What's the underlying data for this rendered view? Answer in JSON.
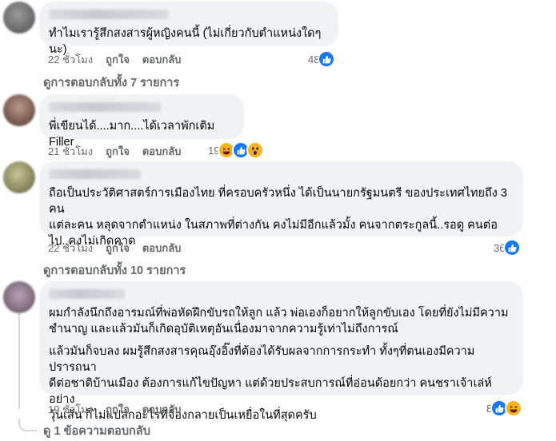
{
  "comments": [
    {
      "text": [
        "ทำไมเรารู้สึกสงสารผู้หญิงคนนี้ (ไม่เกี่ยวกับตำแหน่งใดๆนะ)"
      ],
      "time": "22 ชั่วโมง",
      "like": "ถูกใจ",
      "reply": "ตอบกลับ",
      "reaction_count": "48",
      "reactions": [
        "like"
      ]
    },
    {
      "text": [
        "พี่เขียนได้....มาก....ได้เวลาพักเติม Filler"
      ],
      "time": "21 ชั่วโมง",
      "like": "ถูกใจ",
      "reply": "ตอบกลับ",
      "reaction_count": "19",
      "reactions": [
        "haha",
        "like",
        "wow"
      ]
    },
    {
      "text": [
        "ถือเป็นประวัติศาสตร์การเมืองไทย ที่ครอบครัวหนึ่ง ได้เป็นนายกรัฐมนตรี ของประเทศไทยถึง 3 คน\nแต่ละคน หลุดจากตำแหน่ง ในสภาพที่ต่างกัน คงไม่มีอีกแล้วมั้ง คนจากตระกูลนี้..รอดู คนต่อ\nไป..คงไม่เกิดคาด"
      ],
      "time": "22 ชั่วโมง",
      "like": "ถูกใจ",
      "reply": "ตอบกลับ",
      "reaction_count": "36",
      "reactions": [
        "like"
      ]
    },
    {
      "text": [
        "ผมกำลังนึกถึงอารมณ์ที่พ่อหัดฝึกขับรถให้ลูก แล้ว พ่อเองก็อยากให้ลูกขับเอง โดยที่ยังไม่มีความ\nชำนาญ และแล้วมันก็เกิดอุบัติเหตุอันเนื่องมาจากความรู้เท่าไม่ถึงการณ์",
        "แล้วมันก็จบลง ผมรู้สึกสงสารคุณอุ๊งอิ๊งที่ต้องได้รับผลจากการกระทำ ทั้งๆที่ตนเองมีความปรารถนา\nดีต่อชาติบ้านเมือง ต้องการแก้ไขปัญหา แต่ด้วยประสบการณ์ที่อ่อนด้อยกว่า คนชราเจ้าเล่ห์อย่าง\nวุ้นเส้น ก็ไม่แปลกอะไรที่จ้องกลายเป็นเหยื่อในที่สุดครับ"
      ],
      "time": "19 ชั่วโมง",
      "like": "ถูกใจ",
      "reply": "ตอบกลับ",
      "reaction_count": "8",
      "reactions": [
        "like",
        "haha"
      ]
    }
  ],
  "view_replies": [
    "ดูการตอบกลับทั้ง 7 รายการ",
    "ดูการตอบกลับทั้ง 10 รายการ",
    "ดู 1 ข้อความตอบกลับ"
  ],
  "colors": {
    "bubble": "#f0f2f5",
    "meta": "#65676b",
    "like_blue": "#1877f2",
    "emoji_yellow": "#f7b125"
  }
}
